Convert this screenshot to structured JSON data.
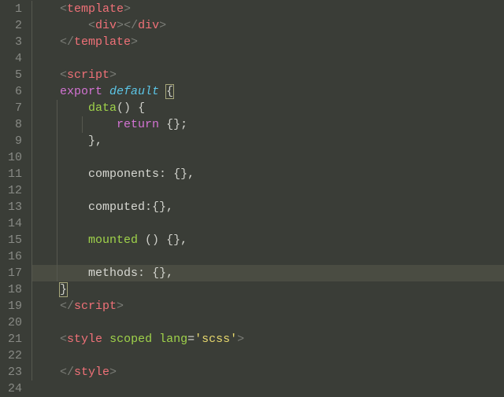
{
  "gutter": {
    "start": 1,
    "end": 24
  },
  "activeLine": 17,
  "lines": {
    "l1": [
      [
        "guide",
        "ig1"
      ],
      [
        "white",
        "    "
      ],
      [
        "gray",
        "<"
      ],
      [
        "tag",
        "template"
      ],
      [
        "gray",
        ">"
      ]
    ],
    "l2": [
      [
        "guide",
        "ig1"
      ],
      [
        "white",
        "        "
      ],
      [
        "gray",
        "<"
      ],
      [
        "tag",
        "div"
      ],
      [
        "gray",
        ">"
      ],
      [
        "gray",
        "</"
      ],
      [
        "tag",
        "div"
      ],
      [
        "gray",
        ">"
      ]
    ],
    "l3": [
      [
        "guide",
        "ig1"
      ],
      [
        "white",
        "    "
      ],
      [
        "gray",
        "</"
      ],
      [
        "tag",
        "template"
      ],
      [
        "gray",
        ">"
      ]
    ],
    "l4": [
      [
        "guide",
        "ig1"
      ]
    ],
    "l5": [
      [
        "guide",
        "ig1"
      ],
      [
        "white",
        "    "
      ],
      [
        "gray",
        "<"
      ],
      [
        "tag",
        "script"
      ],
      [
        "gray",
        ">"
      ]
    ],
    "l6": [
      [
        "guide",
        "ig1"
      ],
      [
        "white",
        "    "
      ],
      [
        "keyword",
        "export"
      ],
      [
        "white",
        " "
      ],
      [
        "storage",
        "default"
      ],
      [
        "white",
        " "
      ],
      [
        "bmatch",
        "{"
      ]
    ],
    "l7": [
      [
        "guide",
        "ig1"
      ],
      [
        "guide",
        "ig2"
      ],
      [
        "white",
        "        "
      ],
      [
        "funcdef",
        "data"
      ],
      [
        "punc",
        "()"
      ],
      [
        "white",
        " "
      ],
      [
        "punc",
        "{"
      ]
    ],
    "l8": [
      [
        "guide",
        "ig1"
      ],
      [
        "guide",
        "ig2"
      ],
      [
        "guide",
        "ig3"
      ],
      [
        "white",
        "            "
      ],
      [
        "keyword",
        "return"
      ],
      [
        "white",
        " "
      ],
      [
        "punc",
        "{}"
      ],
      [
        "prop",
        ";"
      ]
    ],
    "l9": [
      [
        "guide",
        "ig1"
      ],
      [
        "guide",
        "ig2"
      ],
      [
        "white",
        "        "
      ],
      [
        "punc",
        "}"
      ],
      [
        "prop",
        ","
      ]
    ],
    "l10": [
      [
        "guide",
        "ig1"
      ],
      [
        "guide",
        "ig2"
      ]
    ],
    "l11": [
      [
        "guide",
        "ig1"
      ],
      [
        "guide",
        "ig2"
      ],
      [
        "white",
        "        "
      ],
      [
        "prop",
        "components"
      ],
      [
        "punc",
        ":"
      ],
      [
        "white",
        " "
      ],
      [
        "punc",
        "{}"
      ],
      [
        "prop",
        ","
      ]
    ],
    "l12": [
      [
        "guide",
        "ig1"
      ],
      [
        "guide",
        "ig2"
      ]
    ],
    "l13": [
      [
        "guide",
        "ig1"
      ],
      [
        "guide",
        "ig2"
      ],
      [
        "white",
        "        "
      ],
      [
        "prop",
        "computed"
      ],
      [
        "punc",
        ":{}"
      ],
      [
        "prop",
        ","
      ]
    ],
    "l14": [
      [
        "guide",
        "ig1"
      ],
      [
        "guide",
        "ig2"
      ]
    ],
    "l15": [
      [
        "guide",
        "ig1"
      ],
      [
        "guide",
        "ig2"
      ],
      [
        "white",
        "        "
      ],
      [
        "funcdef",
        "mounted"
      ],
      [
        "white",
        " "
      ],
      [
        "punc",
        "()"
      ],
      [
        "white",
        " "
      ],
      [
        "punc",
        "{}"
      ],
      [
        "prop",
        ","
      ]
    ],
    "l16": [
      [
        "guide",
        "ig1"
      ],
      [
        "guide",
        "ig2"
      ]
    ],
    "l17": [
      [
        "guide",
        "ig1"
      ],
      [
        "guide",
        "ig2"
      ],
      [
        "white",
        "        "
      ],
      [
        "prop",
        "methods"
      ],
      [
        "punc",
        ":"
      ],
      [
        "white",
        " "
      ],
      [
        "punc",
        "{}"
      ],
      [
        "prop",
        ","
      ]
    ],
    "l18": [
      [
        "guide",
        "ig1"
      ],
      [
        "white",
        "    "
      ],
      [
        "bmatch",
        "}"
      ]
    ],
    "l19": [
      [
        "guide",
        "ig1"
      ],
      [
        "white",
        "    "
      ],
      [
        "gray",
        "</"
      ],
      [
        "tag",
        "script"
      ],
      [
        "gray",
        ">"
      ]
    ],
    "l20": [
      [
        "guide",
        "ig1"
      ]
    ],
    "l21": [
      [
        "guide",
        "ig1"
      ],
      [
        "white",
        "    "
      ],
      [
        "gray",
        "<"
      ],
      [
        "tag",
        "style"
      ],
      [
        "white",
        " "
      ],
      [
        "attr",
        "scoped"
      ],
      [
        "white",
        " "
      ],
      [
        "attr",
        "lang"
      ],
      [
        "prop",
        "="
      ],
      [
        "string",
        "'scss'"
      ],
      [
        "gray",
        ">"
      ]
    ],
    "l22": [
      [
        "guide",
        "ig1"
      ]
    ],
    "l23": [
      [
        "guide",
        "ig1"
      ],
      [
        "white",
        "    "
      ],
      [
        "gray",
        "</"
      ],
      [
        "tag",
        "style"
      ],
      [
        "gray",
        ">"
      ]
    ],
    "l24": []
  }
}
